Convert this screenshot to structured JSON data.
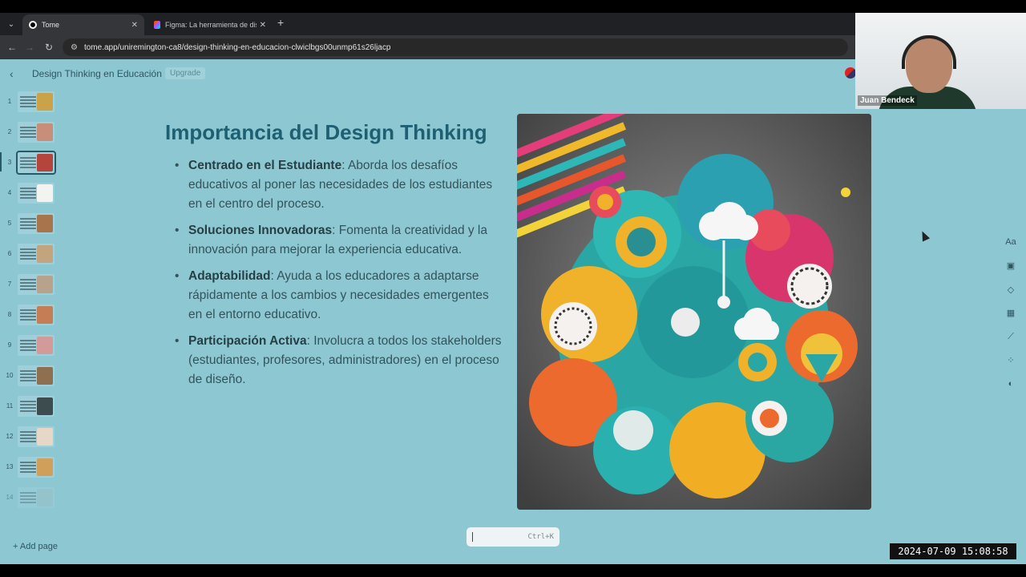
{
  "browser": {
    "tabs": [
      {
        "title": "Tome",
        "active": true
      },
      {
        "title": "Figma: La herramienta de diseño",
        "active": false
      }
    ],
    "url": "tome.app/uniremington-ca8/design-thinking-en-educacion-clwiclbgs00unmp61s26ljacp"
  },
  "app": {
    "doc_title": "Design Thinking en Educación",
    "upgrade_label": "Upgrade",
    "add_page_label": "Add page",
    "selected_page": 3,
    "pages": [
      {
        "num": "1",
        "pic": "#c9a24a"
      },
      {
        "num": "2",
        "pic": "#c98e7a"
      },
      {
        "num": "3",
        "pic": "#b4443c"
      },
      {
        "num": "4",
        "pic": "#f3f3ef"
      },
      {
        "num": "5",
        "pic": "#a7744c"
      },
      {
        "num": "6",
        "pic": "#c2a47e"
      },
      {
        "num": "7",
        "pic": "#b7a28c"
      },
      {
        "num": "8",
        "pic": "#c47d55"
      },
      {
        "num": "9",
        "pic": "#d39a9a"
      },
      {
        "num": "10",
        "pic": "#8e6f4f"
      },
      {
        "num": "11",
        "pic": "#3d4c4f"
      },
      {
        "num": "12",
        "pic": "#e7d7c6"
      },
      {
        "num": "13",
        "pic": "#d0a05a"
      },
      {
        "num": "14",
        "pic": "#9ec1c7"
      }
    ]
  },
  "slide": {
    "title": "Importancia del Design Thinking",
    "bullets": [
      {
        "bold": "Centrado en el Estudiante",
        "text": ": Aborda los desafíos educativos al poner las necesidades de los estudiantes en el centro del proceso."
      },
      {
        "bold": "Soluciones Innovadoras",
        "text": ": Fomenta la creatividad y la innovación para mejorar la experiencia educativa."
      },
      {
        "bold": "Adaptabilidad",
        "text": ": Ayuda a los educadores a adaptarse rápidamente a los cambios y necesidades emergentes en el entorno educativo."
      },
      {
        "bold": "Participación Activa",
        "text": ": Involucra a todos los stakeholders (estudiantes, profesores, administradores) en el proceso de diseño."
      }
    ]
  },
  "command_bar": {
    "hint": "Ctrl+K"
  },
  "tools": [
    {
      "name": "text-tool",
      "glyph": "Aa"
    },
    {
      "name": "image-tool",
      "glyph": "▣"
    },
    {
      "name": "shapes-tool",
      "glyph": "◇"
    },
    {
      "name": "table-tool",
      "glyph": "▦"
    },
    {
      "name": "chart-tool",
      "glyph": "⟋"
    },
    {
      "name": "apps-tool",
      "glyph": "⁘"
    },
    {
      "name": "theme-tool",
      "glyph": "◐"
    }
  ],
  "webcam": {
    "name": "Juan Bendeck"
  },
  "timestamp": "2024-07-09  15:08:58",
  "colors": {
    "app_bg": "#8cc7d2",
    "title": "#1f5f72",
    "chrome": "#35363a"
  }
}
